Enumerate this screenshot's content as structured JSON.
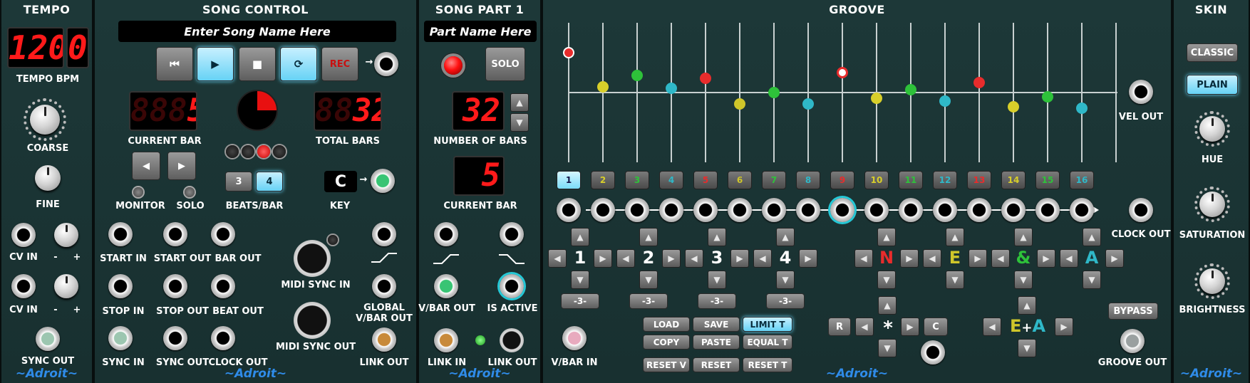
{
  "tempo": {
    "title": "TEMPO",
    "display": "120",
    "display_ghost": "88",
    "display_frac": "0",
    "bpm_label": "TEMPO BPM",
    "coarse_label": "COARSE",
    "fine_label": "FINE",
    "cv_in1": "CV IN",
    "cv_in2": "CV IN",
    "minus": "-",
    "plus": "+",
    "sync_out": "SYNC OUT",
    "brand": "~Adroit~"
  },
  "song": {
    "title": "SONG CONTROL",
    "name_placeholder": "Enter Song Name Here",
    "rec": "REC",
    "current_bar": "5",
    "current_bar_ghost": "888",
    "current_bar_label": "CURRENT BAR",
    "total_bars": "32",
    "total_bars_ghost": "88",
    "total_bars_label": "TOTAL BARS",
    "monitor": "MONITOR",
    "solo": "SOLO",
    "beats_options": [
      "3",
      "4"
    ],
    "beats_selected": "4",
    "beats_label": "BEATS/BAR",
    "key": "C",
    "key_label": "KEY",
    "start_in": "START IN",
    "start_out": "START OUT",
    "bar_out": "BAR OUT",
    "stop_in": "STOP IN",
    "stop_out": "STOP OUT",
    "beat_out": "BEAT OUT",
    "sync_in": "SYNC IN",
    "sync_out": "SYNC OUT",
    "clock_out": "CLOCK OUT",
    "midi_sync_in": "MIDI SYNC IN",
    "midi_sync_out": "MIDI SYNC OUT",
    "global_vbar_out": "GLOBAL\nV/BAR OUT",
    "link_out": "LINK OUT",
    "brand": "~Adroit~"
  },
  "part": {
    "title": "SONG PART 1",
    "name_placeholder": "Part Name Here",
    "solo": "SOLO",
    "num_bars": "32",
    "num_bars_label": "NUMBER OF BARS",
    "current_bar": "5",
    "current_bar_label": "CURRENT BAR",
    "vbar_out": "V/BAR OUT",
    "is_active": "IS ACTIVE",
    "link_in": "LINK IN",
    "link_out": "LINK OUT",
    "brand": "~Adroit~"
  },
  "groove": {
    "title": "GROOVE",
    "steps": [
      "1",
      "2",
      "3",
      "4",
      "5",
      "6",
      "7",
      "8",
      "9",
      "10",
      "11",
      "12",
      "13",
      "14",
      "15",
      "16"
    ],
    "step_colors": [
      "#25c8d6",
      "#d8cf2a",
      "#2ec23a",
      "#2fb8c8",
      "#e82c2c",
      "#cfc62a",
      "#2ec23a",
      "#2fb8c8",
      "#e82c2c",
      "#d8cf2a",
      "#2ec23a",
      "#2fb8c8",
      "#e82c2c",
      "#d8cf2a",
      "#2ec23a",
      "#2fb8c8"
    ],
    "velocities": [
      0.7,
      0.1,
      0.3,
      0.08,
      0.25,
      -0.2,
      0.0,
      -0.2,
      0.35,
      -0.1,
      0.05,
      -0.15,
      0.18,
      -0.25,
      -0.08,
      -0.28
    ],
    "beats": [
      "1",
      "2",
      "3",
      "4"
    ],
    "triplet": "-3-",
    "letters": [
      "N",
      "E",
      "&",
      "A"
    ],
    "letter_colors": [
      "#e82c2c",
      "#cfc62a",
      "#2ec23a",
      "#2fb8c8"
    ],
    "load": "LOAD",
    "save": "SAVE",
    "limit": "LIMIT T",
    "copy": "COPY",
    "paste": "PASTE",
    "equal": "EQUAL T",
    "reset_v": "RESET V",
    "reset": "RESET",
    "reset_t": "RESET T",
    "r": "R",
    "c": "C",
    "star": "*",
    "ea": "E+A",
    "vel_out": "VEL OUT",
    "clock_out": "CLOCK OUT",
    "vbar_in": "V/BAR IN",
    "bypass": "BYPASS",
    "groove_out": "GROOVE OUT",
    "brand": "~Adroit~"
  },
  "skin": {
    "title": "SKIN",
    "classic": "CLASSIC",
    "plain": "PLAIN",
    "hue": "HUE",
    "saturation": "SATURATION",
    "brightness": "BRIGHTNESS",
    "brand": "~Adroit~"
  }
}
